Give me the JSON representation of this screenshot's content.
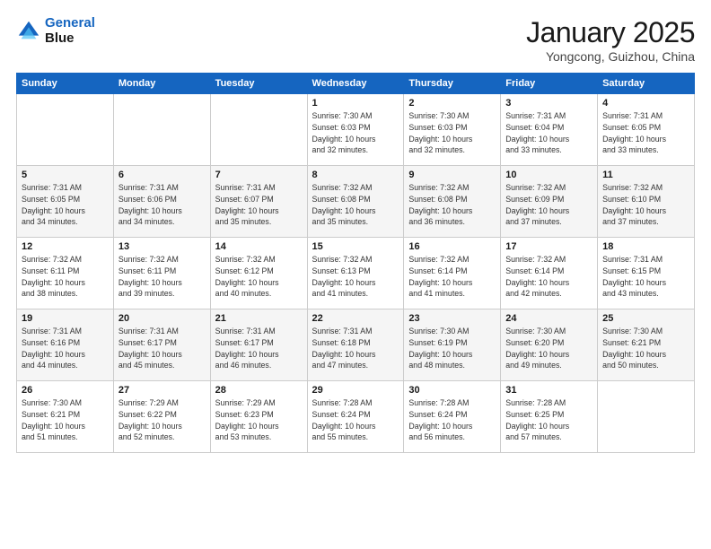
{
  "header": {
    "logo_line1": "General",
    "logo_line2": "Blue",
    "month": "January 2025",
    "location": "Yongcong, Guizhou, China"
  },
  "weekdays": [
    "Sunday",
    "Monday",
    "Tuesday",
    "Wednesday",
    "Thursday",
    "Friday",
    "Saturday"
  ],
  "weeks": [
    [
      {
        "day": "",
        "info": ""
      },
      {
        "day": "",
        "info": ""
      },
      {
        "day": "",
        "info": ""
      },
      {
        "day": "1",
        "info": "Sunrise: 7:30 AM\nSunset: 6:03 PM\nDaylight: 10 hours\nand 32 minutes."
      },
      {
        "day": "2",
        "info": "Sunrise: 7:30 AM\nSunset: 6:03 PM\nDaylight: 10 hours\nand 32 minutes."
      },
      {
        "day": "3",
        "info": "Sunrise: 7:31 AM\nSunset: 6:04 PM\nDaylight: 10 hours\nand 33 minutes."
      },
      {
        "day": "4",
        "info": "Sunrise: 7:31 AM\nSunset: 6:05 PM\nDaylight: 10 hours\nand 33 minutes."
      }
    ],
    [
      {
        "day": "5",
        "info": "Sunrise: 7:31 AM\nSunset: 6:05 PM\nDaylight: 10 hours\nand 34 minutes."
      },
      {
        "day": "6",
        "info": "Sunrise: 7:31 AM\nSunset: 6:06 PM\nDaylight: 10 hours\nand 34 minutes."
      },
      {
        "day": "7",
        "info": "Sunrise: 7:31 AM\nSunset: 6:07 PM\nDaylight: 10 hours\nand 35 minutes."
      },
      {
        "day": "8",
        "info": "Sunrise: 7:32 AM\nSunset: 6:08 PM\nDaylight: 10 hours\nand 35 minutes."
      },
      {
        "day": "9",
        "info": "Sunrise: 7:32 AM\nSunset: 6:08 PM\nDaylight: 10 hours\nand 36 minutes."
      },
      {
        "day": "10",
        "info": "Sunrise: 7:32 AM\nSunset: 6:09 PM\nDaylight: 10 hours\nand 37 minutes."
      },
      {
        "day": "11",
        "info": "Sunrise: 7:32 AM\nSunset: 6:10 PM\nDaylight: 10 hours\nand 37 minutes."
      }
    ],
    [
      {
        "day": "12",
        "info": "Sunrise: 7:32 AM\nSunset: 6:11 PM\nDaylight: 10 hours\nand 38 minutes."
      },
      {
        "day": "13",
        "info": "Sunrise: 7:32 AM\nSunset: 6:11 PM\nDaylight: 10 hours\nand 39 minutes."
      },
      {
        "day": "14",
        "info": "Sunrise: 7:32 AM\nSunset: 6:12 PM\nDaylight: 10 hours\nand 40 minutes."
      },
      {
        "day": "15",
        "info": "Sunrise: 7:32 AM\nSunset: 6:13 PM\nDaylight: 10 hours\nand 41 minutes."
      },
      {
        "day": "16",
        "info": "Sunrise: 7:32 AM\nSunset: 6:14 PM\nDaylight: 10 hours\nand 41 minutes."
      },
      {
        "day": "17",
        "info": "Sunrise: 7:32 AM\nSunset: 6:14 PM\nDaylight: 10 hours\nand 42 minutes."
      },
      {
        "day": "18",
        "info": "Sunrise: 7:31 AM\nSunset: 6:15 PM\nDaylight: 10 hours\nand 43 minutes."
      }
    ],
    [
      {
        "day": "19",
        "info": "Sunrise: 7:31 AM\nSunset: 6:16 PM\nDaylight: 10 hours\nand 44 minutes."
      },
      {
        "day": "20",
        "info": "Sunrise: 7:31 AM\nSunset: 6:17 PM\nDaylight: 10 hours\nand 45 minutes."
      },
      {
        "day": "21",
        "info": "Sunrise: 7:31 AM\nSunset: 6:17 PM\nDaylight: 10 hours\nand 46 minutes."
      },
      {
        "day": "22",
        "info": "Sunrise: 7:31 AM\nSunset: 6:18 PM\nDaylight: 10 hours\nand 47 minutes."
      },
      {
        "day": "23",
        "info": "Sunrise: 7:30 AM\nSunset: 6:19 PM\nDaylight: 10 hours\nand 48 minutes."
      },
      {
        "day": "24",
        "info": "Sunrise: 7:30 AM\nSunset: 6:20 PM\nDaylight: 10 hours\nand 49 minutes."
      },
      {
        "day": "25",
        "info": "Sunrise: 7:30 AM\nSunset: 6:21 PM\nDaylight: 10 hours\nand 50 minutes."
      }
    ],
    [
      {
        "day": "26",
        "info": "Sunrise: 7:30 AM\nSunset: 6:21 PM\nDaylight: 10 hours\nand 51 minutes."
      },
      {
        "day": "27",
        "info": "Sunrise: 7:29 AM\nSunset: 6:22 PM\nDaylight: 10 hours\nand 52 minutes."
      },
      {
        "day": "28",
        "info": "Sunrise: 7:29 AM\nSunset: 6:23 PM\nDaylight: 10 hours\nand 53 minutes."
      },
      {
        "day": "29",
        "info": "Sunrise: 7:28 AM\nSunset: 6:24 PM\nDaylight: 10 hours\nand 55 minutes."
      },
      {
        "day": "30",
        "info": "Sunrise: 7:28 AM\nSunset: 6:24 PM\nDaylight: 10 hours\nand 56 minutes."
      },
      {
        "day": "31",
        "info": "Sunrise: 7:28 AM\nSunset: 6:25 PM\nDaylight: 10 hours\nand 57 minutes."
      },
      {
        "day": "",
        "info": ""
      }
    ]
  ]
}
